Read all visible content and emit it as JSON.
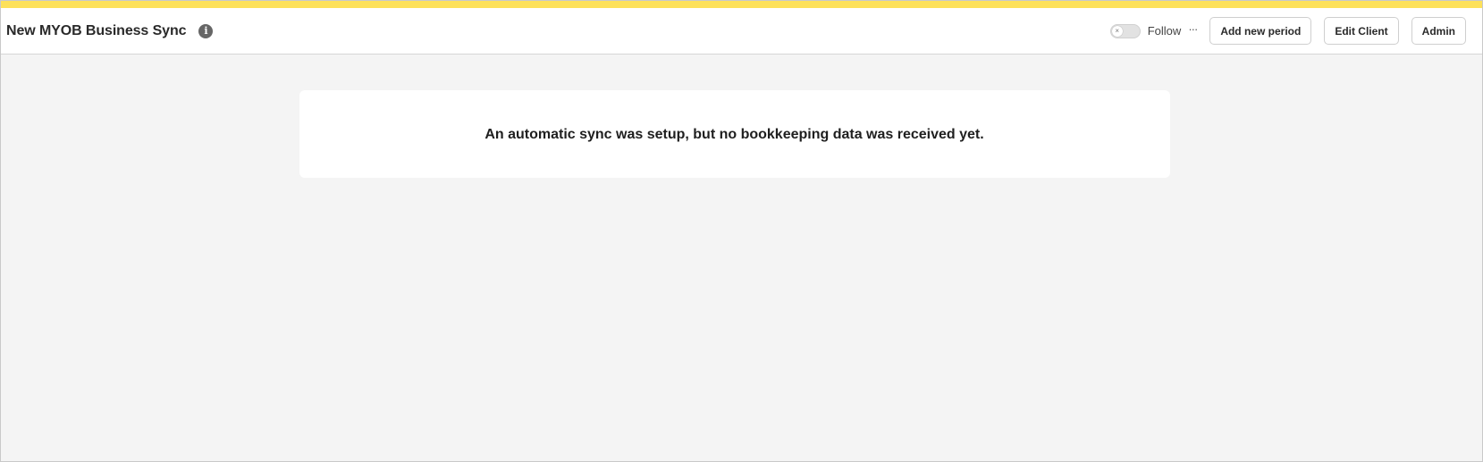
{
  "colors": {
    "accent_bar": "#fde15a",
    "background": "#f4f4f4",
    "card": "#ffffff"
  },
  "header": {
    "title": "New MYOB Business Sync",
    "info_icon": "info-icon",
    "follow_toggle": {
      "label": "Follow",
      "state": "off",
      "knob_glyph": "×"
    },
    "more_glyph": "···",
    "buttons": {
      "add_period": "Add new period",
      "edit_client": "Edit Client",
      "admin": "Admin"
    }
  },
  "main": {
    "notice": "An automatic sync was setup, but no bookkeeping data was received yet."
  }
}
